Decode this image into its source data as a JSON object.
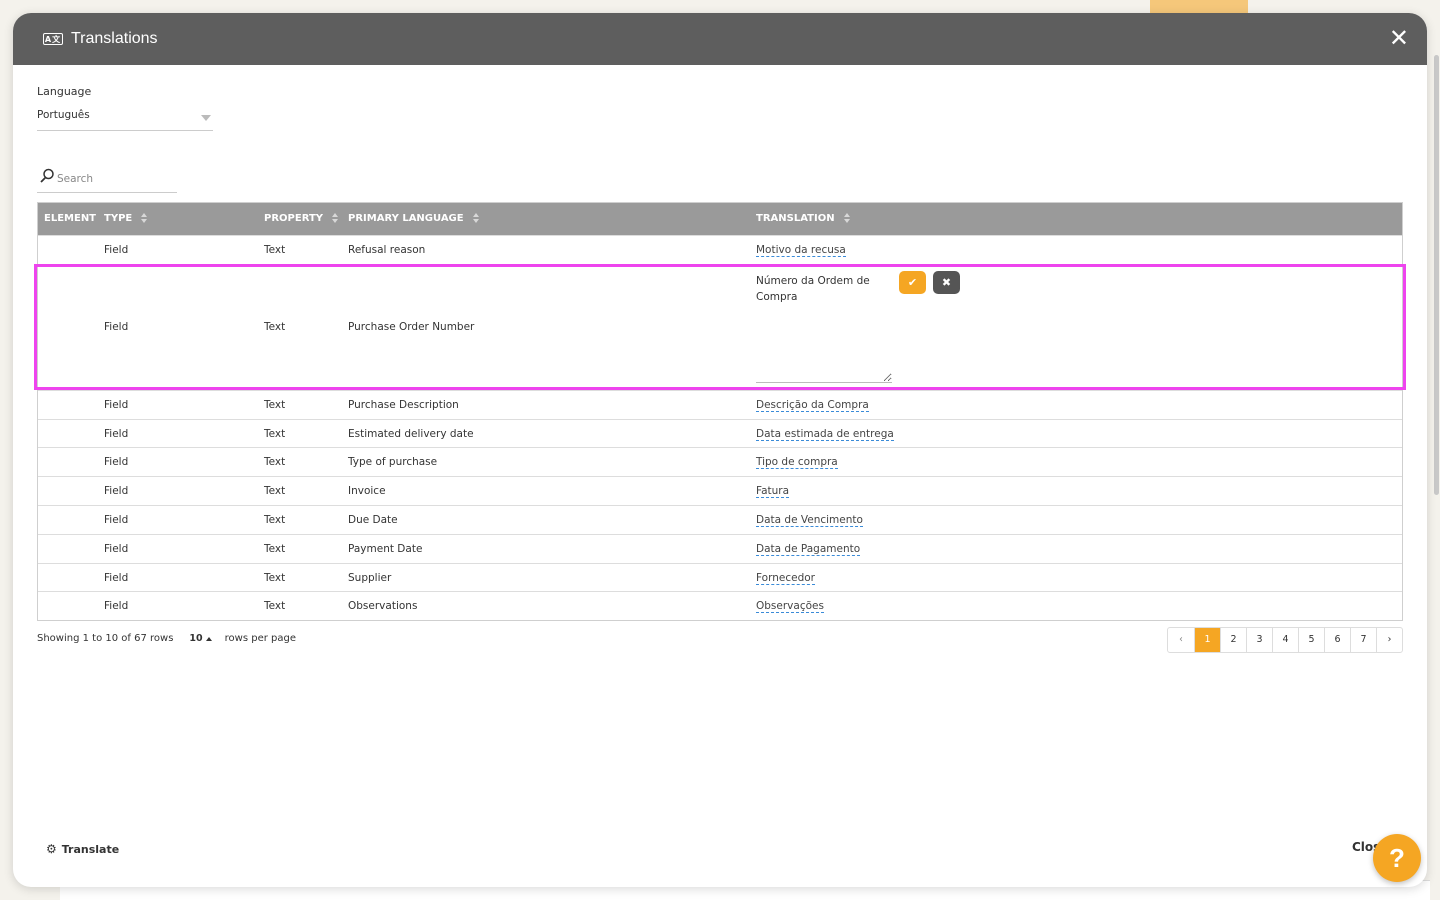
{
  "modal": {
    "title": "Translations",
    "close_symbol": "✕",
    "icon": "translate-icon"
  },
  "language": {
    "label": "Language",
    "value": "Português"
  },
  "search": {
    "placeholder": "Search"
  },
  "table": {
    "headers": {
      "element": "ELEMENT",
      "type": "TYPE",
      "property": "PROPERTY",
      "primary": "PRIMARY LANGUAGE",
      "translation": "TRANSLATION"
    },
    "rows": [
      {
        "type": "Field",
        "property": "Text",
        "primary": "Refusal reason",
        "translation": "Motivo da recusa"
      },
      {
        "type": "Field",
        "property": "Text",
        "primary": "Purchase Order Number",
        "translation": "Número da Ordem de Compra",
        "editing": true
      },
      {
        "type": "Field",
        "property": "Text",
        "primary": "Purchase Description",
        "translation": "Descrição da Compra"
      },
      {
        "type": "Field",
        "property": "Text",
        "primary": "Estimated delivery date",
        "translation": "Data estimada de entrega"
      },
      {
        "type": "Field",
        "property": "Text",
        "primary": "Type of purchase",
        "translation": "Tipo de compra"
      },
      {
        "type": "Field",
        "property": "Text",
        "primary": "Invoice",
        "translation": "Fatura"
      },
      {
        "type": "Field",
        "property": "Text",
        "primary": "Due Date",
        "translation": "Data de Vencimento"
      },
      {
        "type": "Field",
        "property": "Text",
        "primary": "Payment Date",
        "translation": "Data de Pagamento"
      },
      {
        "type": "Field",
        "property": "Text",
        "primary": "Supplier",
        "translation": "Fornecedor"
      },
      {
        "type": "Field",
        "property": "Text",
        "primary": "Observations",
        "translation": "Observações"
      }
    ],
    "edit_buttons": {
      "ok": "✔",
      "cancel": "✖"
    }
  },
  "footer": {
    "showing": "Showing 1 to 10 of 67 rows",
    "rows_per_page_value": "10",
    "rows_per_page_label": "rows per page"
  },
  "pagination": {
    "prev": "‹",
    "pages": [
      "1",
      "2",
      "3",
      "4",
      "5",
      "6",
      "7"
    ],
    "active": "1",
    "next": "›"
  },
  "actions": {
    "translate_label": "Translate",
    "close_label": "Clos",
    "help_label": "?"
  },
  "colors": {
    "header_bg": "#5e5e5e",
    "table_header_bg": "#9a9a9a",
    "accent": "#f5a623",
    "highlight": "#ee44ee"
  }
}
